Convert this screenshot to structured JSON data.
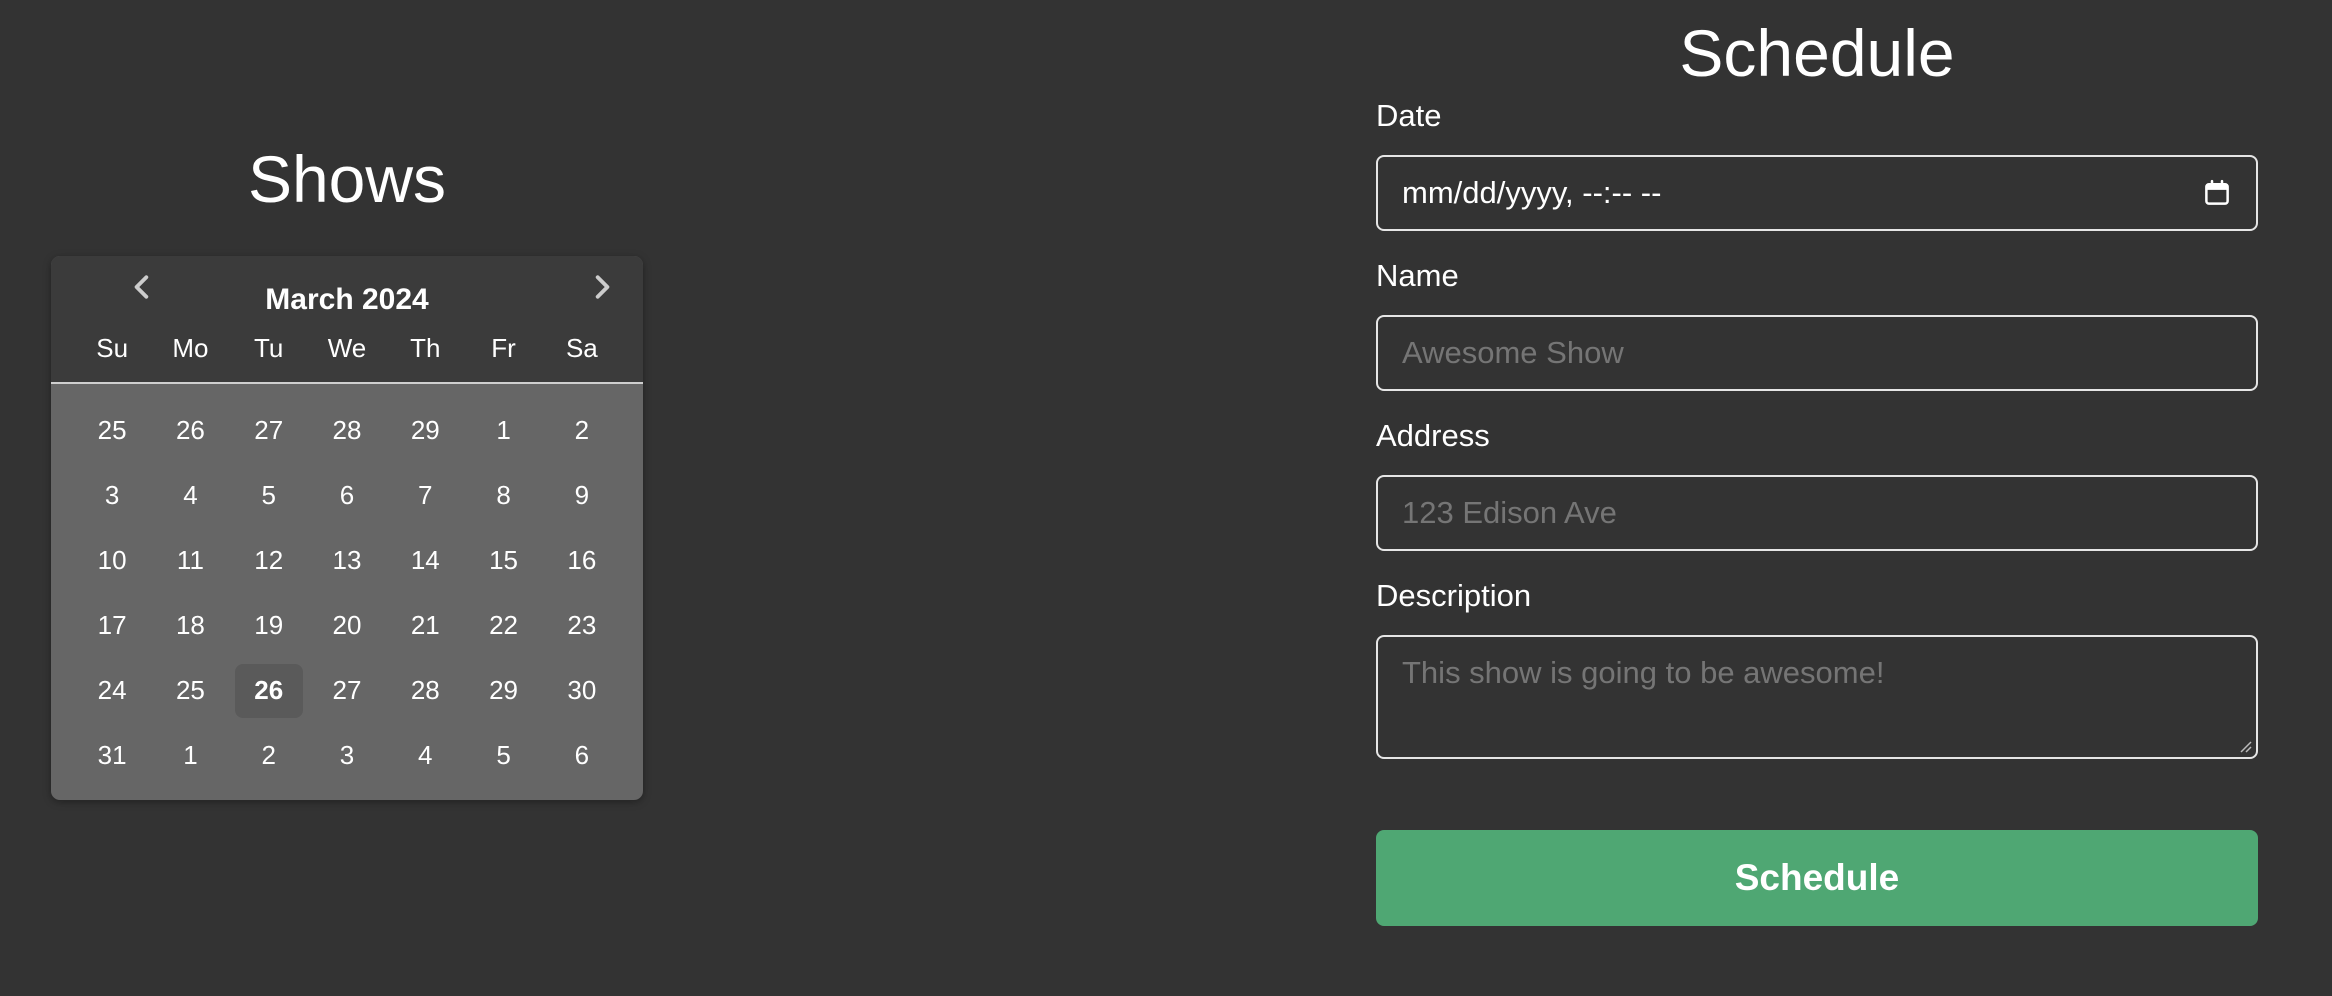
{
  "shows": {
    "title": "Shows",
    "calendar": {
      "month_label": "March 2024",
      "weekdays": [
        "Su",
        "Mo",
        "Tu",
        "We",
        "Th",
        "Fr",
        "Sa"
      ],
      "weeks": [
        [
          "25",
          "26",
          "27",
          "28",
          "29",
          "1",
          "2"
        ],
        [
          "3",
          "4",
          "5",
          "6",
          "7",
          "8",
          "9"
        ],
        [
          "10",
          "11",
          "12",
          "13",
          "14",
          "15",
          "16"
        ],
        [
          "17",
          "18",
          "19",
          "20",
          "21",
          "22",
          "23"
        ],
        [
          "24",
          "25",
          "26",
          "27",
          "28",
          "29",
          "30"
        ],
        [
          "31",
          "1",
          "2",
          "3",
          "4",
          "5",
          "6"
        ]
      ],
      "today": "26"
    }
  },
  "schedule": {
    "title": "Schedule",
    "date": {
      "label": "Date",
      "value": "mm/dd/yyyy, --:-- --"
    },
    "name": {
      "label": "Name",
      "placeholder": "Awesome Show"
    },
    "address": {
      "label": "Address",
      "placeholder": "123 Edison Ave"
    },
    "description": {
      "label": "Description",
      "placeholder": "This show is going to be awesome!"
    },
    "submit_label": "Schedule"
  },
  "colors": {
    "background": "#333333",
    "calendar_body": "#666666",
    "calendar_header": "#3b3b3b",
    "accent_green": "#4fa773",
    "placeholder_text": "#757575"
  }
}
